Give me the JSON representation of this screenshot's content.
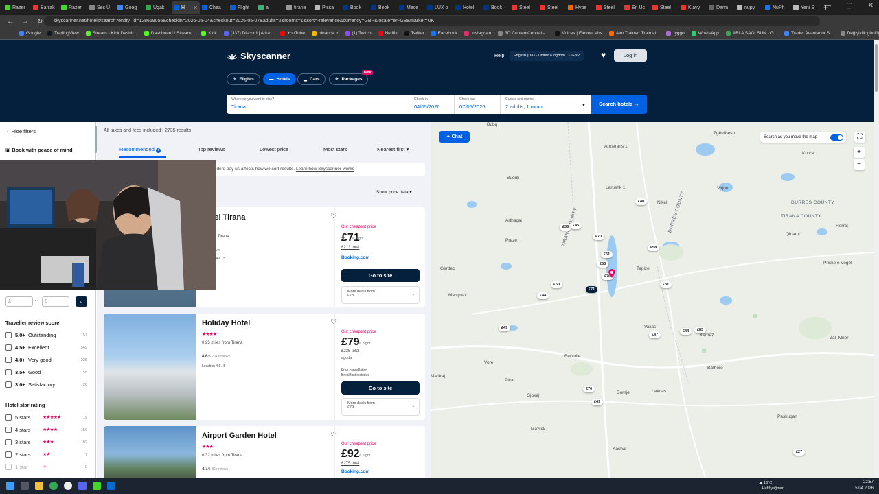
{
  "browser": {
    "tabs": [
      {
        "label": "Razer",
        "color": "#44d62c"
      },
      {
        "label": "Barrak",
        "color": "#e33"
      },
      {
        "label": "Razer",
        "color": "#44d62c"
      },
      {
        "label": "Ses Ü",
        "color": "#888"
      },
      {
        "label": "Goog",
        "color": "#4285f4"
      },
      {
        "label": "Ugak",
        "color": "#34a853"
      },
      {
        "label": "H",
        "color": "#0062e3",
        "active": true
      },
      {
        "label": "Chea",
        "color": "#0062e3"
      },
      {
        "label": "Flight",
        "color": "#0062e3"
      },
      {
        "label": "a",
        "color": "#4a7"
      },
      {
        "label": "tirana",
        "color": "#999"
      },
      {
        "label": "Pissa",
        "color": "#bbb"
      },
      {
        "label": "Book",
        "color": "#003580"
      },
      {
        "label": "Book",
        "color": "#003580"
      },
      {
        "label": "Mece",
        "color": "#003580"
      },
      {
        "label": "LUX o",
        "color": "#003580"
      },
      {
        "label": "Hotel",
        "color": "#003580"
      },
      {
        "label": "Book",
        "color": "#003580"
      },
      {
        "label": "Steel",
        "color": "#e33"
      },
      {
        "label": "Steel",
        "color": "#e33"
      },
      {
        "label": "Hype",
        "color": "#e60"
      },
      {
        "label": "Steel",
        "color": "#e33"
      },
      {
        "label": "En Uc",
        "color": "#e33"
      },
      {
        "label": "Steel",
        "color": "#e33"
      },
      {
        "label": "Klavy",
        "color": "#e33"
      },
      {
        "label": "Darm",
        "color": "#666"
      },
      {
        "label": "nupy",
        "color": "#bbb"
      },
      {
        "label": "NuPh",
        "color": "#1a73e8"
      },
      {
        "label": "Yeni S",
        "color": "#bbb"
      }
    ],
    "url": "skyscanner.net/hotels/search?entity_id=128669056&checkin=2026-05-04&checkout=2026-05-07&adults=2&rooms=1&sort=-relevance&currency=GBP&locale=en-GB&market=UK",
    "bookmarks": [
      "Google",
      "TradingView",
      "Stream - Kick Dashb...",
      "Dashboard / Stream...",
      "Kick",
      "(337) Discord | Arka...",
      "YouTube",
      "binance tr",
      "(1) Twitch",
      "Netflix",
      "Twitter",
      "Facebook",
      "Instagram",
      "3D ContentCentral -...",
      "Voices | ElevenLabs",
      "Aim Trainer: Train ai...",
      "ryggo",
      "WhatsApp",
      "ABLA SAOLSUN - G...",
      "Trader Avantador S...",
      "Değişiklik günlüğü -..."
    ]
  },
  "header": {
    "logo": "Skyscanner",
    "help": "Help",
    "locale": "English (UK) · United Kingdom · £ GBP",
    "login": "Log in",
    "tabs": [
      "Flights",
      "Hotels",
      "Cars",
      "Packages"
    ],
    "new_badge": "New",
    "search": {
      "where_label": "Where do you want to stay?",
      "where_value": "Tirana",
      "checkin_label": "Check-in",
      "checkin_value": "04/05/2026",
      "checkout_label": "Check-out",
      "checkout_value": "07/05/2026",
      "guests_label": "Guests and rooms",
      "guests_value": "2 adults, 1 room",
      "button": "Search hotels"
    }
  },
  "filters": {
    "hide": "Hide filters",
    "peace": "Book with peace of mind",
    "price_min": "£",
    "price_max": "£",
    "review_title": "Traveller review score",
    "reviews": [
      {
        "score": "5.0+",
        "label": "Outstanding",
        "count": "157"
      },
      {
        "score": "4.5+",
        "label": "Excellent",
        "count": "549"
      },
      {
        "score": "4.0+",
        "label": "Very good",
        "count": "235"
      },
      {
        "score": "3.5+",
        "label": "Good",
        "count": "55"
      },
      {
        "score": "3.0+",
        "label": "Satisfactory",
        "count": "20"
      }
    ],
    "star_title": "Hotel star rating",
    "star_rows": [
      {
        "label": "5 stars",
        "stars": "★★★★★",
        "count": "19"
      },
      {
        "label": "4 stars",
        "stars": "★★★★",
        "count": "150"
      },
      {
        "label": "3 stars",
        "stars": "★★★",
        "count": "102"
      },
      {
        "label": "2 stars",
        "stars": "★★",
        "count": "7"
      },
      {
        "label": "1 star",
        "stars": "★",
        "count": "0"
      }
    ]
  },
  "results": {
    "summary": "All taxes and fees included | 2735 results",
    "sort_tabs": [
      "Recommended",
      "Top reviews",
      "Lowest price",
      "Most stars",
      "Nearest first"
    ],
    "notice": "iders pay us affects how we sort results.",
    "notice_link": "Learn how Skyscanner works",
    "show_price": "Show price data",
    "hotels": [
      {
        "name": "Hotel Tirana",
        "stars": "★★★",
        "distance": "les from Tirana",
        "rating": "",
        "reviews": "597 reviews",
        "location": "Location 4.6 / 5",
        "cheapest": "Our cheapest price",
        "price": "£71",
        "per": "a night",
        "total": "£213 total",
        "provider": "Booking.com",
        "button": "Go to site",
        "more": "More deals from",
        "more_price": "£73"
      },
      {
        "name": "Holiday Hotel",
        "stars": "★★★★",
        "distance": "0.25 miles from Tirana",
        "rating": "4.6",
        "rating_of": "/5",
        "reviews": "204 reviews",
        "location": "Location 4.6 / 5",
        "cheapest": "Our cheapest price",
        "price": "£79",
        "per": "a night",
        "total": "£235 total",
        "provider": "agoda",
        "perk1": "Free cancellation",
        "perk2": "Breakfast included",
        "button": "Go to site",
        "more": "More deals from",
        "more_price": "£79"
      },
      {
        "name": "Airport Garden Hotel",
        "stars": "★★★",
        "distance": "0.32 miles from Tirana",
        "rating": "4.7",
        "rating_of": "/5",
        "reviews": "86 reviews",
        "cheapest": "Our cheapest price",
        "price": "£92",
        "per": "a night",
        "total": "£275 total",
        "provider": "Booking.com"
      }
    ]
  },
  "map": {
    "chat": "Chat",
    "move_label": "Search as you move the map",
    "towns": [
      "Bubq",
      "Armerans 1",
      "Zgërdhesh",
      "Kurcaj",
      "Buduli",
      "Larushk 1",
      "Virjon",
      "Nikel",
      "DURRES COUNTY",
      "TIRANA COUNTY",
      "Qinami",
      "Herraj",
      "Arthaçaj",
      "Preze",
      "Tapize",
      "Priske e Vogël",
      "Gerdec",
      "Zall-Mner",
      "Marqinat",
      "Valias",
      "Kamez",
      "Vore",
      "Berxulle",
      "Bathore",
      "Marikaj",
      "Picar",
      "Gjokaj",
      "Domje",
      "Laknas",
      "Paskuqan",
      "Mazrek",
      "Kashar",
      "DURRES COUNTY",
      "TIRANA COUNTY"
    ],
    "prices": [
      "£40",
      "£36",
      "£45",
      "£70",
      "£58",
      "£61",
      "£53",
      "£76",
      "£60",
      "£44",
      "£71",
      "£31",
      "£49",
      "£47",
      "£44",
      "£85",
      "£70",
      "£49",
      "£27"
    ]
  },
  "taskbar": {
    "weather_temp": "16°C",
    "weather_desc": "Hafif yağmur",
    "time": "22:57",
    "date": "5.04.2026"
  }
}
